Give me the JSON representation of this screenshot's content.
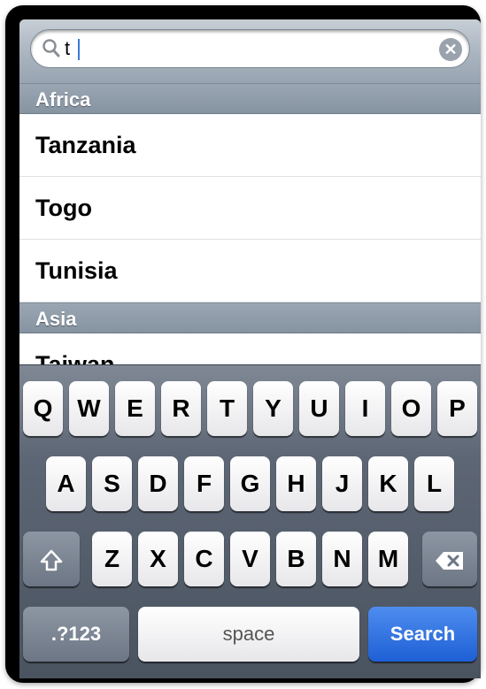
{
  "search": {
    "value": "t",
    "placeholder": ""
  },
  "sections": [
    {
      "header": "Africa",
      "items": [
        "Tanzania",
        "Togo",
        "Tunisia"
      ]
    },
    {
      "header": "Asia",
      "items": [
        "Taiwan"
      ]
    }
  ],
  "keyboard": {
    "row1": [
      "Q",
      "W",
      "E",
      "R",
      "T",
      "Y",
      "U",
      "I",
      "O",
      "P"
    ],
    "row2": [
      "A",
      "S",
      "D",
      "F",
      "G",
      "H",
      "J",
      "K",
      "L"
    ],
    "row3": [
      "Z",
      "X",
      "C",
      "V",
      "B",
      "N",
      "M"
    ],
    "numbers_label": ".?123",
    "space_label": "space",
    "search_label": "Search"
  },
  "colors": {
    "accent": "#1e5fd6",
    "section_header": "#8d9aa8"
  },
  "icons": {
    "search": "search-icon",
    "clear": "clear-icon",
    "shift": "shift-icon",
    "delete": "delete-icon"
  }
}
